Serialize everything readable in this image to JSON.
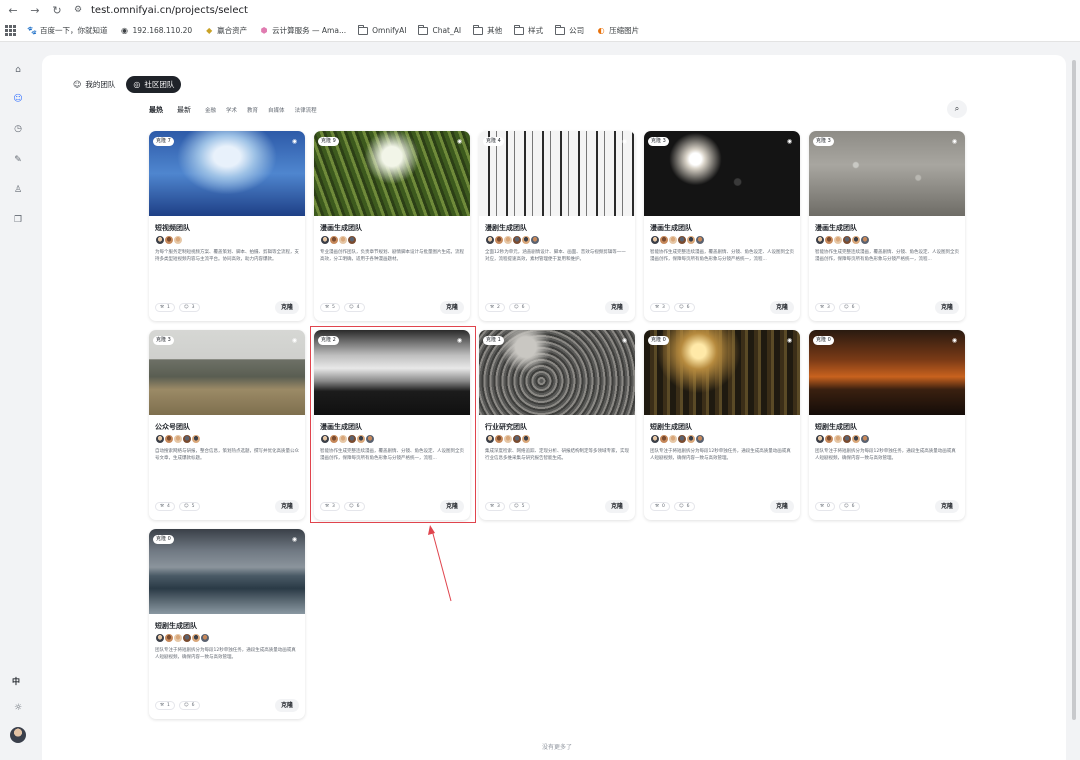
{
  "browser": {
    "url": "test.omnifyai.cn/projects/select",
    "bookmarks": [
      {
        "label": "百度一下，你就知道",
        "icon": "baidu-paw-icon",
        "folder": false
      },
      {
        "label": "192.168.110.20",
        "icon": "globe-icon",
        "folder": false
      },
      {
        "label": "赢合资产",
        "icon": "gold-leaf-icon",
        "folder": false
      },
      {
        "label": "云计算服务 — Ama...",
        "icon": "aws-cube-icon",
        "folder": false
      },
      {
        "label": "OmnifyAI",
        "icon": "folder-icon",
        "folder": true
      },
      {
        "label": "Chat_AI",
        "icon": "folder-icon",
        "folder": true
      },
      {
        "label": "其他",
        "icon": "folder-icon",
        "folder": true
      },
      {
        "label": "样式",
        "icon": "folder-icon",
        "folder": true
      },
      {
        "label": "公司",
        "icon": "folder-icon",
        "folder": true
      },
      {
        "label": "压缩图片",
        "icon": "compress-app-icon",
        "folder": false
      }
    ]
  },
  "sidebar": {
    "icons": [
      "home-icon",
      "team-icon",
      "history-icon",
      "tool-icon",
      "user-icon",
      "copy-icon"
    ],
    "active_index": 1,
    "language": "中",
    "theme_icon": "sun-icon"
  },
  "tabs": [
    {
      "label": "我的团队",
      "icon": "team-icon",
      "active": false
    },
    {
      "label": "社区团队",
      "icon": "community-icon",
      "active": true
    }
  ],
  "filters": {
    "sort": [
      {
        "label": "最热",
        "active": true
      },
      {
        "label": "最新",
        "active": false
      }
    ],
    "categories": [
      "金融",
      "学术",
      "教育",
      "自媒体",
      "法律流程"
    ]
  },
  "clone_label": "克隆",
  "cards": [
    {
      "badge": "克隆 7",
      "title": "短视频团队",
      "desc": "为每个服务定制短视频方案、覆盖策划、脚本、拍摄、剪辑等全流程，支持多类型短视频内容与主流平台。协同高效，助力内容爆款。",
      "tools": "1",
      "members": "3",
      "image_theme": "sky-clouds",
      "avatar_count": 3
    },
    {
      "badge": "克隆 9",
      "title": "漫画生成团队",
      "desc": "专业漫画创作团队，负责章节规划、剧情脚本设计与批量图片生成，流程高效，分工明确，适用于各种漫画题材。",
      "tools": "5",
      "members": "4",
      "image_theme": "forest-canopy",
      "avatar_count": 4
    },
    {
      "badge": "克隆 4",
      "title": "漫剧生成团队",
      "desc": "全面12秒为单元，涵盖剧情设计、脚本、画面、音效与视频剪辑等一一对应，流程提速高效，素材管理便于复用和维护。",
      "tools": "2",
      "members": "6",
      "image_theme": "knolling-tools",
      "avatar_count": 6
    },
    {
      "badge": "克隆 3",
      "title": "漫画生成团队",
      "desc": "智能协作生成完整连续漫画，覆盖剧情、分镜、角色设定、人设图到全页漫画创作，保障每页所有角色形象与分镜严格统一，流程...",
      "tools": "3",
      "members": "6",
      "image_theme": "rain-lamp",
      "avatar_count": 6
    },
    {
      "badge": "克隆 3",
      "title": "漫画生成团队",
      "desc": "智能协作生成完整连续漫画，覆盖剧情、分镜、角色设定、人设图到全页漫画创作，保障每页所有角色形象与分镜严格统一，流程...",
      "tools": "3",
      "members": "6",
      "image_theme": "rain-window",
      "avatar_count": 6
    },
    {
      "badge": "克隆 3",
      "title": "公众号团队",
      "desc": "自动搜索网络与研报，整合信息，策划热点选题，撰写并优化高质量公众号文章，生成爆款标题。",
      "tools": "4",
      "members": "5",
      "image_theme": "mountain-plain",
      "avatar_count": 5
    },
    {
      "badge": "克隆 2",
      "title": "漫画生成团队",
      "desc": "智能协作生成完整连续漫画，覆盖剧情、分镜、角色设定、人设图到全页漫画创作，保障每页所有角色形象与分镜严格统一，流程...",
      "tools": "3",
      "members": "6",
      "image_theme": "foggy-hills",
      "avatar_count": 6
    },
    {
      "badge": "克隆 1",
      "title": "行业研究团队",
      "desc": "集成深度检索、网络追踪、定现分析、研报结构制定等多领域专家，实现行业信息多维采集与研究报告智能生成。",
      "tools": "3",
      "members": "5",
      "image_theme": "textured-rock",
      "avatar_count": 5
    },
    {
      "badge": "克隆 0",
      "title": "短剧生成团队",
      "desc": "团队专注于将短剧拆分为每段12秒单独任务，通段生成高质量动画或真人短剧视频，确保内容一致与高效管理。",
      "tools": "0",
      "members": "6",
      "image_theme": "sunlit-forest",
      "avatar_count": 6
    },
    {
      "badge": "克隆 0",
      "title": "短剧生成团队",
      "desc": "团队专注于将短剧拆分为每段12秒单独任务，通段生成高质量动画或真人短剧视频，确保内容一致与高效管理。",
      "tools": "0",
      "members": "6",
      "image_theme": "sunset-house",
      "avatar_count": 6
    },
    {
      "badge": "克隆 0",
      "title": "短剧生成团队",
      "desc": "团队专注于将短剧拆分为每段12秒单独任务，通段生成高质量动画或真人短剧视频，确保内容一致与高效管理。",
      "tools": "1",
      "members": "6",
      "image_theme": "coastal-mountains",
      "avatar_count": 6
    }
  ],
  "footer": {
    "no_more": "没有更多了"
  },
  "colors": {
    "accent": "#3370ff",
    "highlight": "#e0444d",
    "dark_tab": "#1f2329"
  }
}
